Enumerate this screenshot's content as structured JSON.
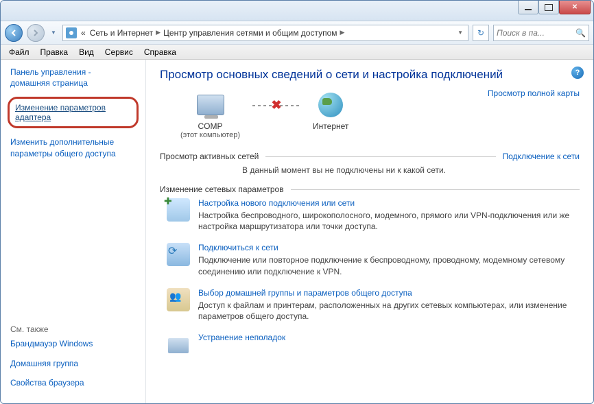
{
  "titlebar": {},
  "nav": {
    "breadcrumb_prefix": "«",
    "breadcrumb1": "Сеть и Интернет",
    "breadcrumb2": "Центр управления сетями и общим доступом",
    "search_placeholder": "Поиск в па..."
  },
  "menu": {
    "file": "Файл",
    "edit": "Правка",
    "view": "Вид",
    "tools": "Сервис",
    "help": "Справка"
  },
  "sidebar": {
    "home": "Панель управления -\nдомашняя страница",
    "adapter_settings": "Изменение параметров адаптера",
    "advanced_sharing": "Изменить дополнительные параметры общего доступа",
    "see_also_hdr": "См. также",
    "firewall": "Брандмауэр Windows",
    "homegroup": "Домашняя группа",
    "browser": "Свойства браузера"
  },
  "main": {
    "title": "Просмотр основных сведений о сети и настройка подключений",
    "full_map": "Просмотр полной карты",
    "comp_name": "COMP",
    "comp_sub": "(этот компьютер)",
    "internet": "Интернет",
    "active_nets_hdr": "Просмотр активных сетей",
    "connect_link": "Подключение к сети",
    "no_net_msg": "В данный момент вы не подключены ни к какой сети.",
    "change_hdr": "Изменение сетевых параметров",
    "actions": [
      {
        "title": "Настройка нового подключения или сети",
        "desc": "Настройка беспроводного, широкополосного, модемного, прямого или VPN-подключения или же настройка маршрутизатора или точки доступа."
      },
      {
        "title": "Подключиться к сети",
        "desc": "Подключение или повторное подключение к беспроводному, проводному, модемному сетевому соединению или подключение к VPN."
      },
      {
        "title": "Выбор домашней группы и параметров общего доступа",
        "desc": "Доступ к файлам и принтерам, расположенных на других сетевых компьютерах, или изменение параметров общего доступа."
      },
      {
        "title": "Устранение неполадок",
        "desc": ""
      }
    ]
  }
}
